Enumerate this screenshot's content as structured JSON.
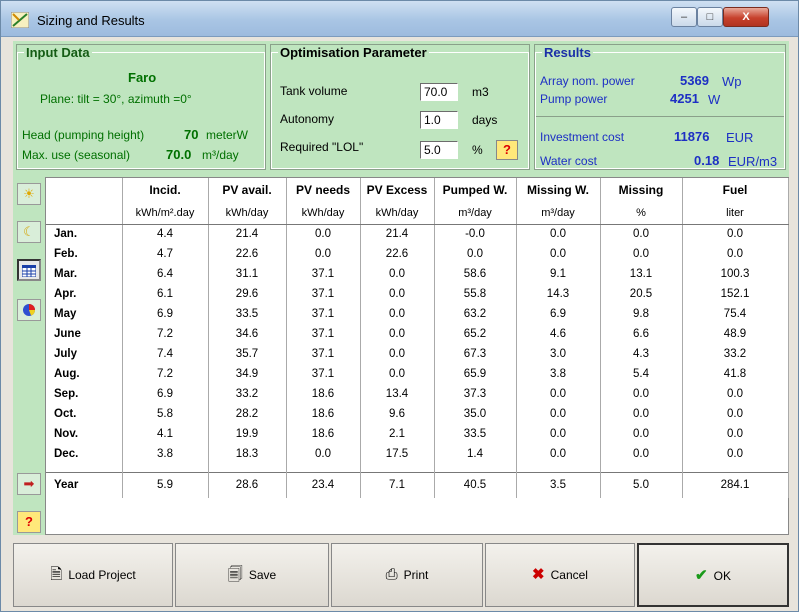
{
  "window": {
    "title": "Sizing and Results",
    "min": "–",
    "max": "□",
    "close": "X"
  },
  "input": {
    "legend": "Input Data",
    "site": "Faro",
    "plane": "Plane: tilt = 30°, azimuth =0°",
    "head_label": "Head (pumping height)",
    "head_value": "70",
    "head_unit": "meterW",
    "maxuse_label": "Max. use (seasonal)",
    "maxuse_value": "70.0",
    "maxuse_unit": "m³/day"
  },
  "opt": {
    "legend": "Optimisation Parameter",
    "tank_label": "Tank volume",
    "tank_value": "70.0",
    "tank_unit": "m3",
    "autonomy_label": "Autonomy",
    "autonomy_value": "1.0",
    "autonomy_unit": "days",
    "lol_label": "Required \"LOL\"",
    "lol_value": "5.0",
    "lol_unit": "%",
    "help": "?"
  },
  "results": {
    "legend": "Results",
    "array_label": "Array nom. power",
    "array_value": "5369",
    "array_unit": "Wp",
    "pump_label": "Pump power",
    "pump_value": "4251",
    "pump_unit": "W",
    "invest_label": "Investment cost",
    "invest_value": "11876",
    "invest_unit": "EUR",
    "water_label": "Water cost",
    "water_value": "0.18",
    "water_unit": "EUR/m3"
  },
  "table": {
    "headers": [
      "",
      "Incid.",
      "PV avail.",
      "PV needs",
      "PV Excess",
      "Pumped W.",
      "Missing W.",
      "Missing",
      "Fuel"
    ],
    "units": [
      "",
      "kWh/m².day",
      "kWh/day",
      "kWh/day",
      "kWh/day",
      "m³/day",
      "m³/day",
      "%",
      "liter"
    ],
    "rows": [
      [
        "Jan.",
        "4.4",
        "21.4",
        "0.0",
        "21.4",
        "-0.0",
        "0.0",
        "0.0",
        "0.0"
      ],
      [
        "Feb.",
        "4.7",
        "22.6",
        "0.0",
        "22.6",
        "0.0",
        "0.0",
        "0.0",
        "0.0"
      ],
      [
        "Mar.",
        "6.4",
        "31.1",
        "37.1",
        "0.0",
        "58.6",
        "9.1",
        "13.1",
        "100.3"
      ],
      [
        "Apr.",
        "6.1",
        "29.6",
        "37.1",
        "0.0",
        "55.8",
        "14.3",
        "20.5",
        "152.1"
      ],
      [
        "May",
        "6.9",
        "33.5",
        "37.1",
        "0.0",
        "63.2",
        "6.9",
        "9.8",
        "75.4"
      ],
      [
        "June",
        "7.2",
        "34.6",
        "37.1",
        "0.0",
        "65.2",
        "4.6",
        "6.6",
        "48.9"
      ],
      [
        "July",
        "7.4",
        "35.7",
        "37.1",
        "0.0",
        "67.3",
        "3.0",
        "4.3",
        "33.2"
      ],
      [
        "Aug.",
        "7.2",
        "34.9",
        "37.1",
        "0.0",
        "65.9",
        "3.8",
        "5.4",
        "41.8"
      ],
      [
        "Sep.",
        "6.9",
        "33.2",
        "18.6",
        "13.4",
        "37.3",
        "0.0",
        "0.0",
        "0.0"
      ],
      [
        "Oct.",
        "5.8",
        "28.2",
        "18.6",
        "9.6",
        "35.0",
        "0.0",
        "0.0",
        "0.0"
      ],
      [
        "Nov.",
        "4.1",
        "19.9",
        "18.6",
        "2.1",
        "33.5",
        "0.0",
        "0.0",
        "0.0"
      ],
      [
        "Dec.",
        "3.8",
        "18.3",
        "0.0",
        "17.5",
        "1.4",
        "0.0",
        "0.0",
        "0.0"
      ]
    ],
    "year": [
      "Year",
      "5.9",
      "28.6",
      "23.4",
      "7.1",
      "40.5",
      "3.5",
      "5.0",
      "284.1"
    ]
  },
  "sidebar": {
    "help": "?"
  },
  "buttons": {
    "load": "Load Project",
    "save": "Save",
    "print": "Print",
    "cancel": "Cancel",
    "ok": "OK"
  },
  "colors": {
    "panel": "#bfe5bf",
    "green_text": "#007000",
    "blue_text": "#1d2fc4"
  }
}
